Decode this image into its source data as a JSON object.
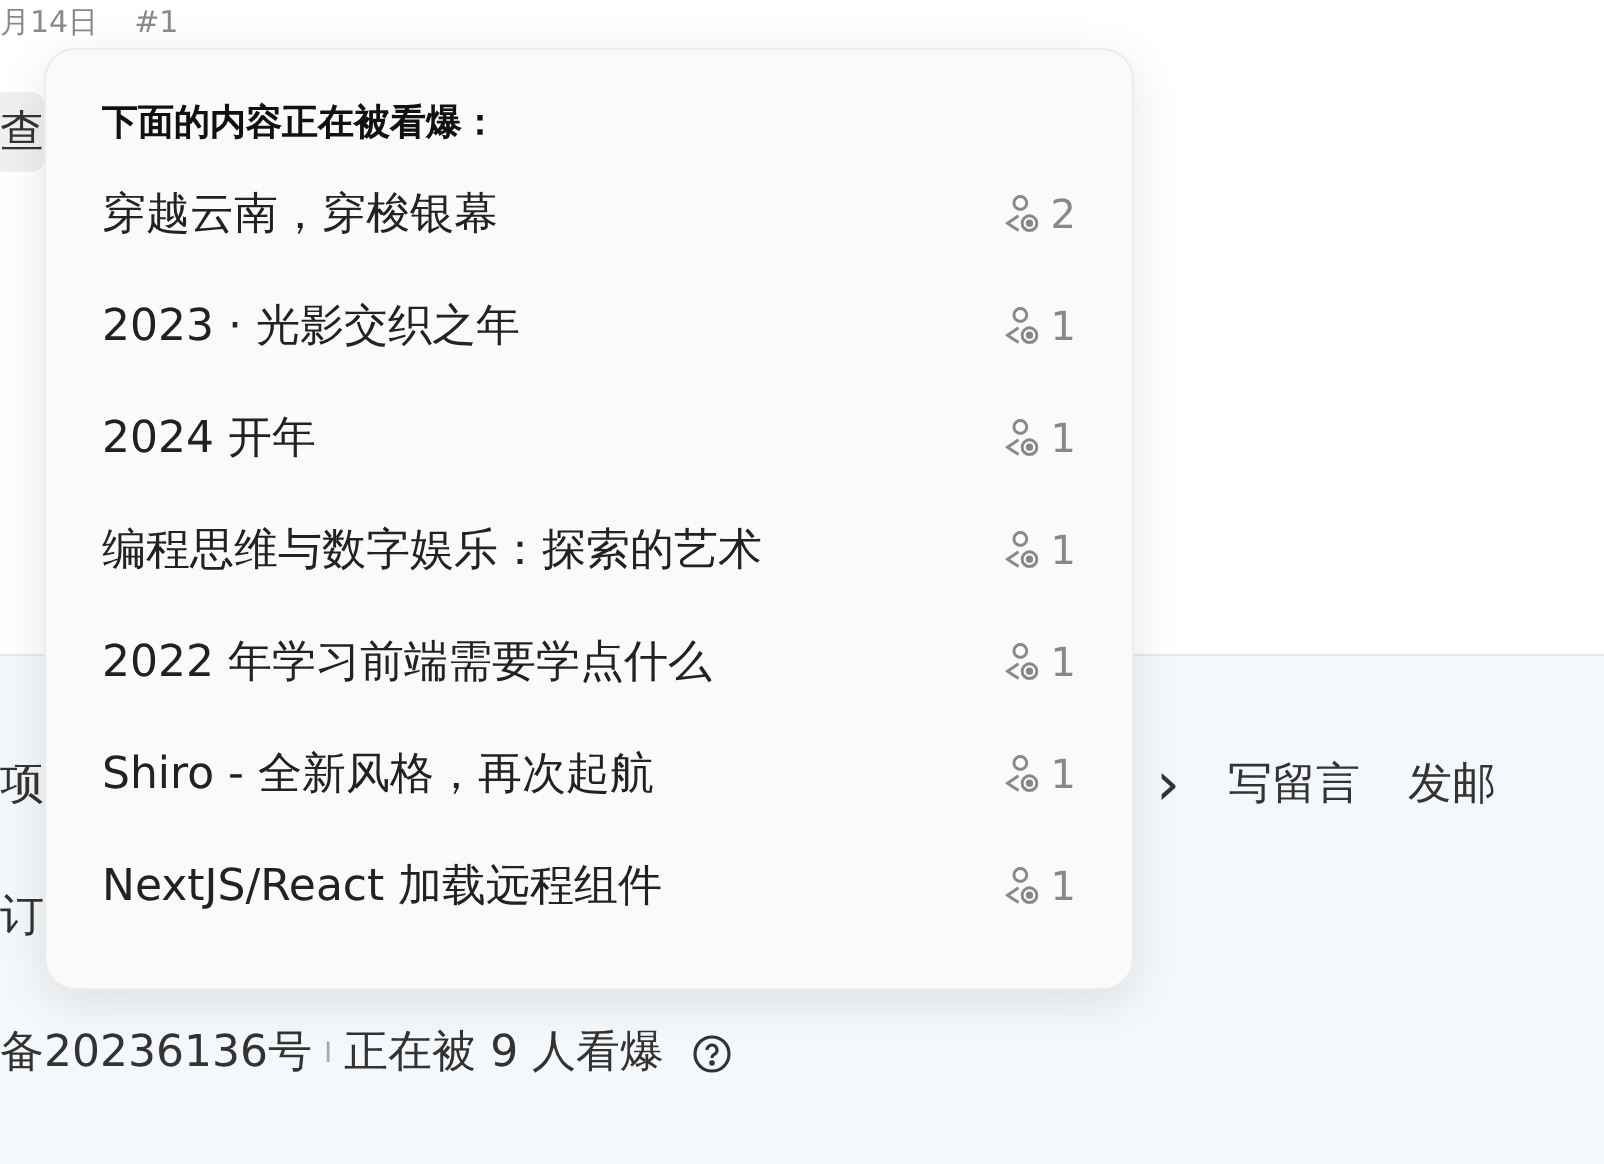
{
  "background": {
    "date": "月14日",
    "post_number": "#1",
    "chip": "查",
    "nav_item": "项",
    "chevron": "›",
    "links": [
      "写留言",
      "发邮"
    ],
    "subscribe": "订",
    "icp": "备20236136号",
    "separator": "I",
    "online": "正在被 9 人看爆"
  },
  "popover": {
    "title": "下面的内容正在被看爆：",
    "items": [
      {
        "title": "穿越云南，穿梭银幕",
        "count": "2"
      },
      {
        "title": "2023 · 光影交织之年",
        "count": "1"
      },
      {
        "title": "2024 开年",
        "count": "1"
      },
      {
        "title": "编程思维与数字娱乐：探索的艺术",
        "count": "1"
      },
      {
        "title": "2022 年学习前端需要学点什么",
        "count": "1"
      },
      {
        "title": "Shiro - 全新风格，再次起航",
        "count": "1"
      },
      {
        "title": "NextJS/React 加载远程组件",
        "count": "1"
      }
    ]
  }
}
